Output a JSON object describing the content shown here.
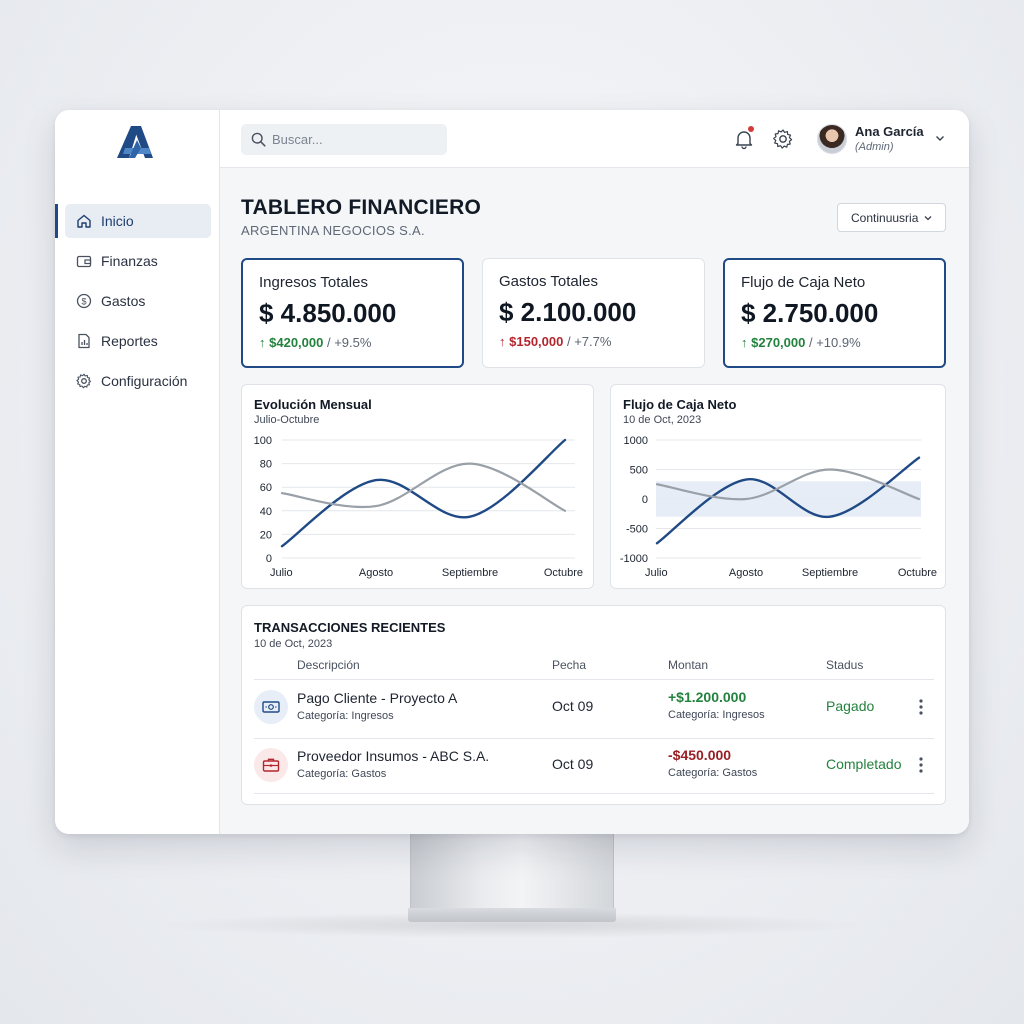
{
  "brand": {
    "logo_letter": "A",
    "color": "#1f4a85"
  },
  "sidebar": {
    "items": [
      {
        "label": "Inicio",
        "icon": "home-icon",
        "active": true
      },
      {
        "label": "Finanzas",
        "icon": "wallet-icon",
        "active": false
      },
      {
        "label": "Gastos",
        "icon": "dollar-circle-icon",
        "active": false
      },
      {
        "label": "Reportes",
        "icon": "report-icon",
        "active": false
      },
      {
        "label": "Configuración",
        "icon": "gear-icon",
        "active": false
      }
    ]
  },
  "topbar": {
    "search_placeholder": "Buscar...",
    "notifications_icon": "bell-icon",
    "settings_icon": "gear-icon",
    "user": {
      "name": "Ana García",
      "role": "(Admin)"
    }
  },
  "header": {
    "title": "TABLERO FINANCIERO",
    "subtitle": "ARGENTINA NEGOCIOS S.A.",
    "period_label": "Continuusria"
  },
  "kpis": [
    {
      "label": "Ingresos Totales",
      "value": "$ 4.850.000",
      "delta_amount": "$420,000",
      "delta_pct": "/ +9.5%",
      "trend": "up",
      "color": "#23823d"
    },
    {
      "label": "Gastos Totales",
      "value": "$ 2.100.000",
      "delta_amount": "$150,000",
      "delta_pct": "/ +7.7%",
      "trend": "up",
      "color": "#b3262e"
    },
    {
      "label": "Flujo de Caja Neto",
      "value": "$ 2.750.000",
      "delta_amount": "$270,000",
      "delta_pct": "/ +10.9%",
      "trend": "up",
      "color": "#23823d"
    }
  ],
  "chart_data": [
    {
      "type": "line",
      "title": "Evolución Mensual",
      "subtitle": "Julio-Octubre",
      "categories": [
        "Julio",
        "Agosto",
        "Septiembre",
        "Octubre"
      ],
      "ylim": [
        0,
        100
      ],
      "yticks": [
        "100",
        "80",
        "60",
        "40",
        "20",
        "0"
      ],
      "grid": true,
      "series": [
        {
          "values": [
            10,
            66,
            35,
            100
          ],
          "color": "#1f4a85"
        },
        {
          "values": [
            55,
            44,
            80,
            40
          ],
          "color": "#9aa0a8"
        }
      ]
    },
    {
      "type": "line",
      "title": "Flujo de Caja Neto",
      "subtitle": "10 de Oct, 2023",
      "categories": [
        "Julio",
        "Agosto",
        "Septiembre",
        "Octubre"
      ],
      "ylim": [
        -1000,
        1000
      ],
      "yticks": [
        "1000",
        "500",
        "0",
        "-500",
        "-1000"
      ],
      "grid": true,
      "band": [
        -300,
        300
      ],
      "series": [
        {
          "values": [
            -750,
            330,
            -300,
            700
          ],
          "color": "#1f4a85"
        },
        {
          "values": [
            250,
            0,
            500,
            0
          ],
          "color": "#9aa0a8"
        }
      ]
    }
  ],
  "transactions": {
    "title": "TRANSACCIONES RECIENTES",
    "subtitle": "10 de Oct, 2023",
    "columns": [
      "Descripción",
      "Pecha",
      "Montan",
      "Stadus"
    ],
    "rows": [
      {
        "icon": "money-icon",
        "description": "Pago Cliente - Proyecto A",
        "category": "Categoría: Ingresos",
        "date": "Oct 09",
        "amount": "+$1.200.000",
        "amount_category": "Categoría: Ingresos",
        "amount_color": "#23823d",
        "status": "Pagado"
      },
      {
        "icon": "briefcase-icon",
        "description": "Proveedor Insumos - ABC S.A.",
        "category": "Categoría: Gastos",
        "date": "Oct 09",
        "amount": "-$450.000",
        "amount_category": "Categoría: Gastos",
        "amount_color": "#9a1f25",
        "status": "Completado"
      }
    ]
  }
}
